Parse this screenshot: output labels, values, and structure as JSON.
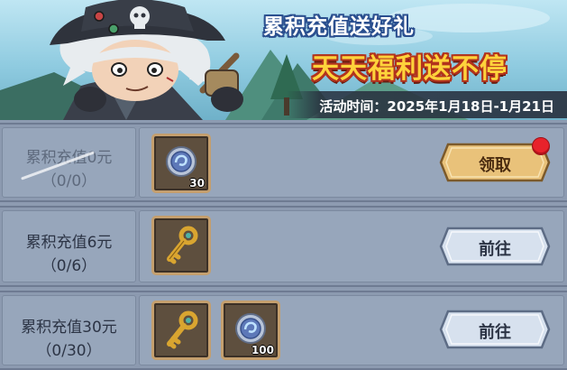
{
  "banner": {
    "title": "累积充值送好礼",
    "subtitle": "天天福利送不停",
    "event_time": "活动时间：2025年1月18日-1月21日"
  },
  "tiers": [
    {
      "label": "累积充值0元",
      "progress": "（0/0）",
      "claimed": true,
      "rewards": [
        {
          "icon": "silver-coin-icon",
          "count": "30"
        }
      ],
      "button": {
        "label": "领取",
        "style": "gold",
        "red_dot": true
      }
    },
    {
      "label": "累积充值6元",
      "progress": "（0/6）",
      "claimed": false,
      "rewards": [
        {
          "icon": "golden-key-icon",
          "count": ""
        }
      ],
      "button": {
        "label": "前往",
        "style": "silver",
        "red_dot": false
      }
    },
    {
      "label": "累积充值30元",
      "progress": "（0/30）",
      "claimed": false,
      "rewards": [
        {
          "icon": "golden-key-icon",
          "count": ""
        },
        {
          "icon": "silver-coin-icon",
          "count": "100"
        }
      ],
      "button": {
        "label": "前往",
        "style": "silver",
        "red_dot": false
      }
    }
  ],
  "colors": {
    "gold_button": "#e9c27a",
    "silver_button": "#d7e1ee",
    "red_dot": "#e8222b",
    "panel": "#97a6bb"
  }
}
